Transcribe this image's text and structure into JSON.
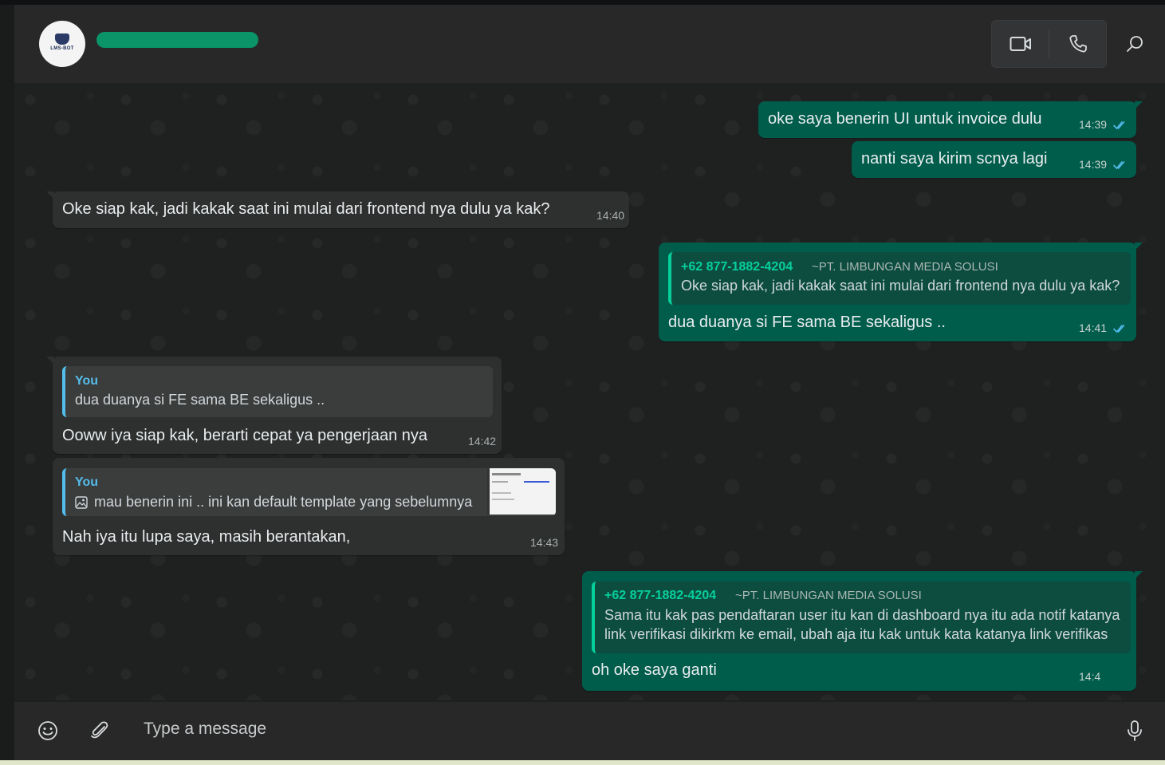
{
  "header": {
    "avatar_label": "LMS-BOT",
    "icons": [
      "video-call-icon",
      "voice-call-icon",
      "search-icon"
    ]
  },
  "messages": [
    {
      "direction": "out",
      "text": "oke saya benerin UI untuk invoice dulu",
      "time": "14:39",
      "status": "read"
    },
    {
      "direction": "out",
      "text": "nanti saya kirim scnya lagi",
      "time": "14:39",
      "status": "read"
    },
    {
      "direction": "in",
      "text": "Oke siap kak, jadi kakak saat ini mulai dari frontend nya dulu ya kak?",
      "time": "14:40"
    },
    {
      "direction": "out",
      "quote": {
        "sender": "+62 877-1882-4204",
        "pushname": "~PT. LIMBUNGAN MEDIA SOLUSI",
        "text": "Oke siap kak, jadi kakak saat ini mulai dari frontend nya dulu ya kak?"
      },
      "text": "dua duanya si FE sama BE sekaligus ..",
      "time": "14:41",
      "status": "read"
    },
    {
      "direction": "in",
      "quote": {
        "sender": "You",
        "text": "dua duanya si FE sama BE sekaligus .."
      },
      "text": "Ooww iya siap kak, berarti cepat ya pengerjaan nya",
      "time": "14:42"
    },
    {
      "direction": "in",
      "quote": {
        "sender": "You",
        "text": "mau benerin ini .. ini kan default template yang sebelumnya",
        "has_image": true
      },
      "text": "Nah iya itu lupa saya, masih berantakan,",
      "time": "14:43"
    },
    {
      "direction": "out",
      "quote": {
        "sender": "+62 877-1882-4204",
        "pushname": "~PT. LIMBUNGAN MEDIA SOLUSI",
        "text_line1": "Sama itu kak pas pendaftaran user itu kan di dashboard nya itu ada notif katanya",
        "text_line2": "link verifikasi dikirkm ke email, ubah aja itu kak untuk kata katanya link verifikas"
      },
      "text": "oh oke saya ganti",
      "time": "14:4"
    }
  ],
  "composer": {
    "placeholder": "Type a message"
  },
  "colors": {
    "outgoing": "#005c4b",
    "incoming": "#2e2f2f",
    "accent": "#06cf9c",
    "read_tick": "#53bdeb"
  }
}
